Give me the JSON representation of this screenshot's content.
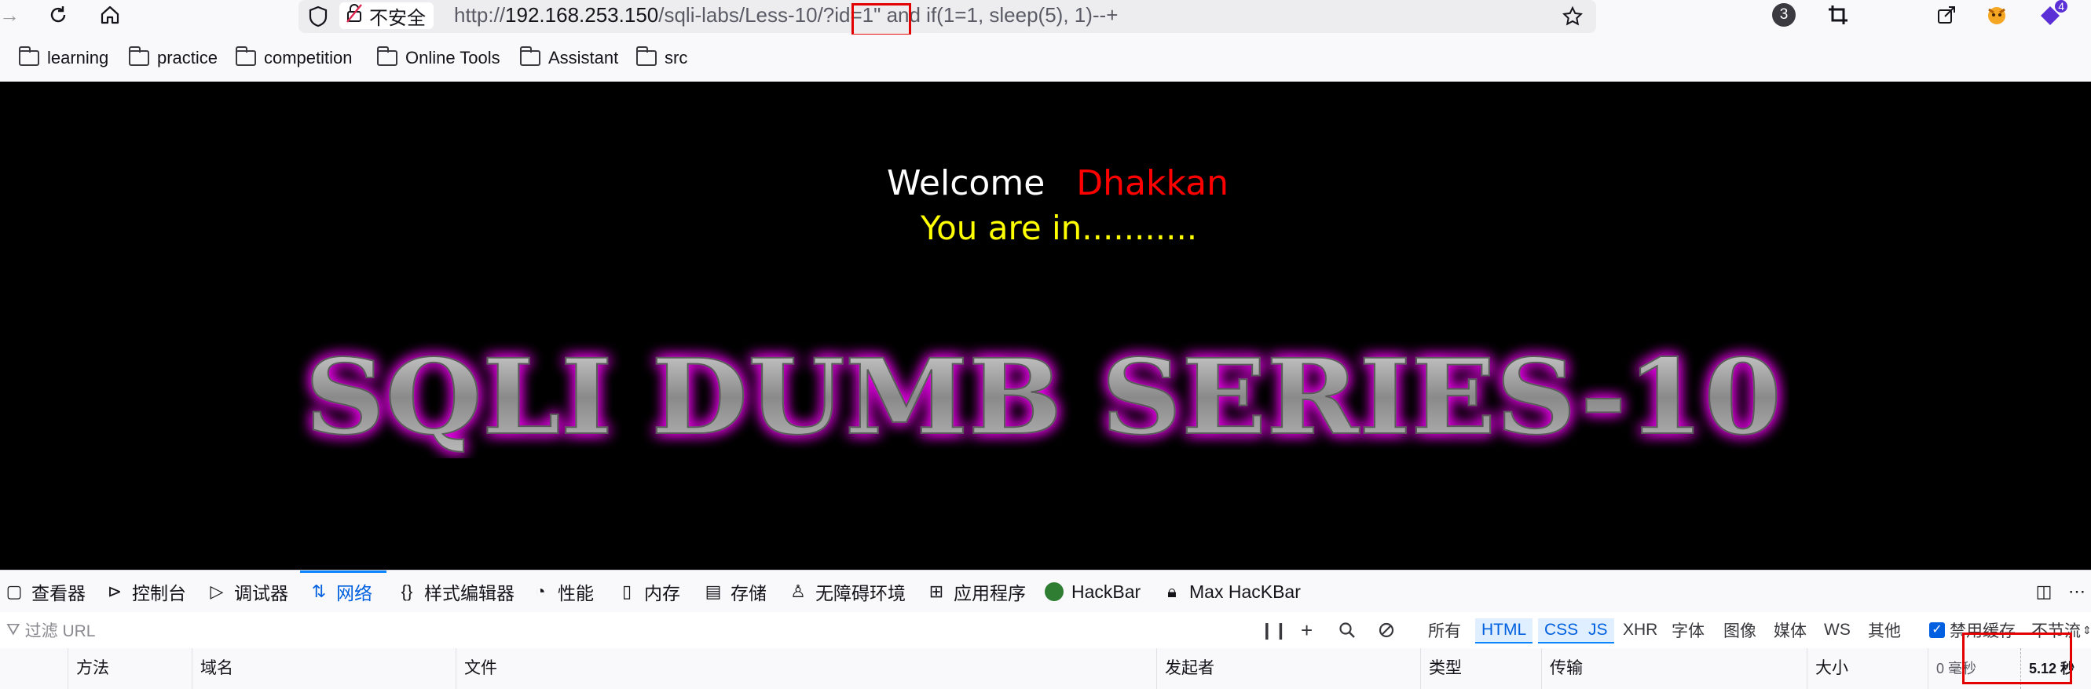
{
  "browser": {
    "url_prefix": "http://",
    "url_host": "192.168.253.150",
    "url_path": "/sqli-labs/Less-10/?id=1\" and if(1=1, sleep(5), 1)--+",
    "security_label": "不安全",
    "extensions_badge": "3",
    "ext_badge_count": "4"
  },
  "bookmarks": [
    {
      "label": "learning"
    },
    {
      "label": "practice"
    },
    {
      "label": "competition"
    },
    {
      "label": "Online Tools"
    },
    {
      "label": "Assistant"
    },
    {
      "label": "src"
    }
  ],
  "page": {
    "welcome": "Welcome",
    "name": "Dhakkan",
    "status": "You are in...........",
    "banner": "SQLI DUMB SERIES-10"
  },
  "devtools": {
    "tabs": [
      {
        "label": "查看器"
      },
      {
        "label": "控制台"
      },
      {
        "label": "调试器"
      },
      {
        "label": "网络"
      },
      {
        "label": "样式编辑器"
      },
      {
        "label": "性能"
      },
      {
        "label": "内存"
      },
      {
        "label": "存储"
      },
      {
        "label": "无障碍环境"
      },
      {
        "label": "应用程序"
      },
      {
        "label": "HackBar"
      },
      {
        "label": "Max HacKBar"
      }
    ],
    "filter_placeholder": "过滤 URL",
    "type_filters": [
      "所有",
      "HTML",
      "CSS",
      "JS",
      "XHR",
      "字体",
      "图像",
      "媒体",
      "WS",
      "其他"
    ],
    "disable_cache_label": "禁用缓存",
    "throttle_label": "不节流",
    "columns": [
      "方法",
      "域名",
      "文件",
      "发起者",
      "类型",
      "传输",
      "大小"
    ],
    "timing_start": "0 毫秒",
    "timing_end": "5.12 秒"
  },
  "colors": {
    "welcome": "#ffffff",
    "name": "#ff0000",
    "status": "#ffff00",
    "banner_glow": "#e000e0",
    "highlight_box": "#e30000",
    "accent": "#0060df"
  }
}
